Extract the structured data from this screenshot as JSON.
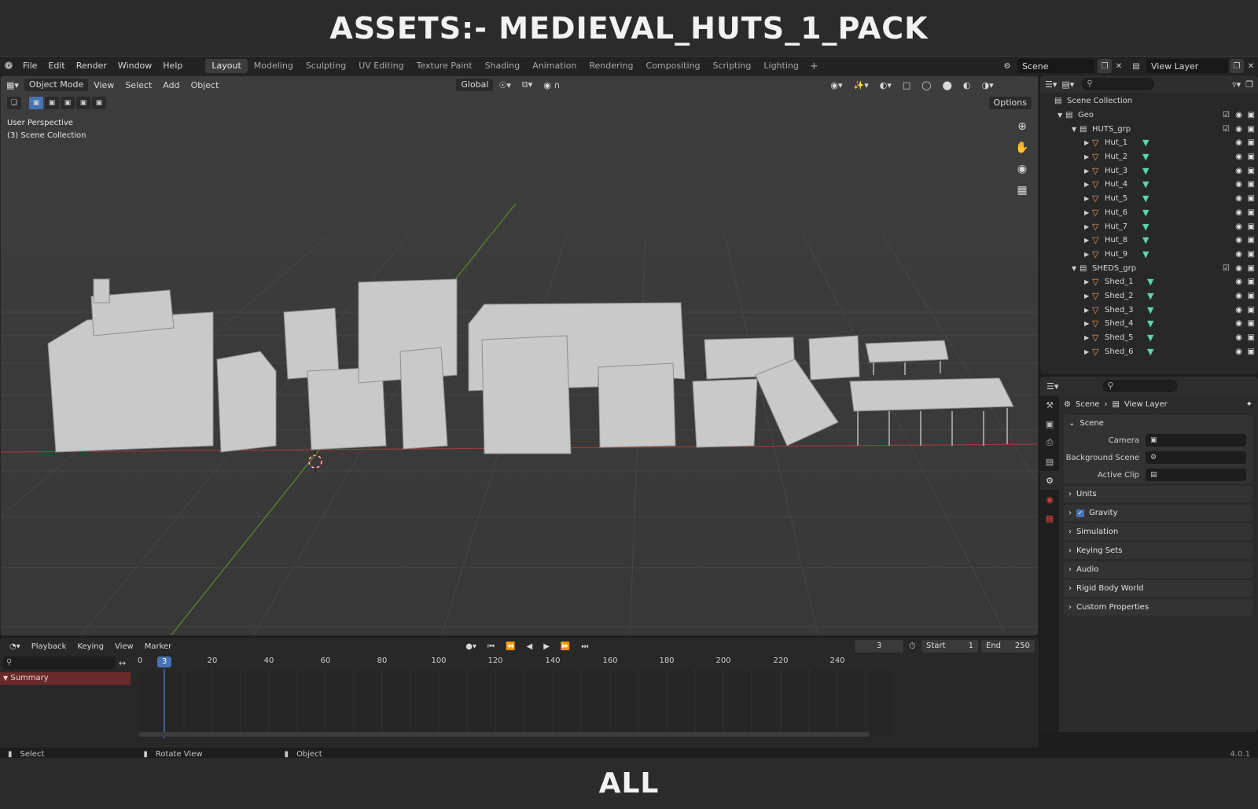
{
  "banner": {
    "title": "ASSETS:- MEDIEVAL_HUTS_1_PACK",
    "footer": "ALL"
  },
  "menus": [
    "File",
    "Edit",
    "Render",
    "Window",
    "Help"
  ],
  "workspace_tabs": [
    "Layout",
    "Modeling",
    "Sculpting",
    "UV Editing",
    "Texture Paint",
    "Shading",
    "Animation",
    "Rendering",
    "Compositing",
    "Scripting",
    "Lighting"
  ],
  "active_tab": "Layout",
  "scene_name": "Scene",
  "view_layer": "View Layer",
  "viewport": {
    "mode": "Object Mode",
    "menus": [
      "View",
      "Select",
      "Add",
      "Object"
    ],
    "transform": "Global",
    "options": "Options",
    "info_line1": "User Perspective",
    "info_line2": "(3) Scene Collection"
  },
  "outliner": {
    "root": "Scene Collection",
    "geo": "Geo",
    "huts_grp": "HUTS_grp",
    "huts": [
      "Hut_1",
      "Hut_2",
      "Hut_3",
      "Hut_4",
      "Hut_5",
      "Hut_6",
      "Hut_7",
      "Hut_8",
      "Hut_9"
    ],
    "sheds_grp": "SHEDS_grp",
    "sheds": [
      "Shed_1",
      "Shed_2",
      "Shed_3",
      "Shed_4",
      "Shed_5",
      "Shed_6"
    ]
  },
  "properties": {
    "crumb_scene": "Scene",
    "crumb_layer": "View Layer",
    "scene_panel": "Scene",
    "camera_label": "Camera",
    "bg_scene_label": "Background Scene",
    "active_clip_label": "Active Clip",
    "panels": [
      "Units",
      "Gravity",
      "Simulation",
      "Keying Sets",
      "Audio",
      "Rigid Body World",
      "Custom Properties"
    ]
  },
  "timeline": {
    "menus": [
      "Playback",
      "Keying",
      "View",
      "Marker"
    ],
    "current_frame": "3",
    "start_label": "Start",
    "start": "1",
    "end_label": "End",
    "end": "250",
    "summary": "Summary",
    "ticks": [
      "20",
      "40",
      "60",
      "80",
      "100",
      "120",
      "140",
      "160",
      "180",
      "200",
      "220",
      "240"
    ]
  },
  "status": {
    "select": "Select",
    "rotate": "Rotate View",
    "object": "Object",
    "version": "4.0.1"
  },
  "colors": {
    "accent": "#4772b3",
    "mesh_icon": "#e8a25a",
    "data_icon": "#5bd6a8",
    "summary": "#6b2a2a"
  }
}
